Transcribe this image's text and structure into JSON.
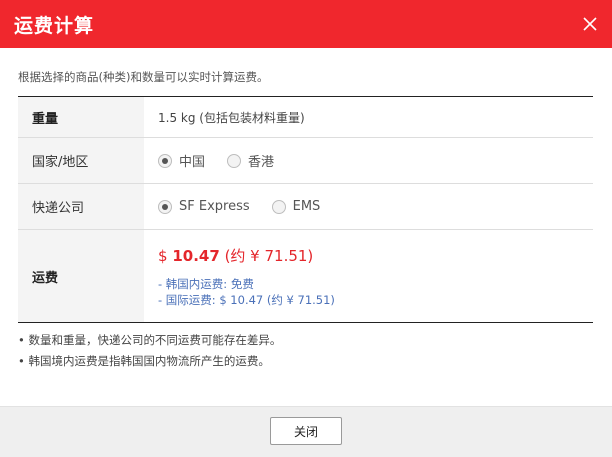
{
  "dialog": {
    "title": "运费计算",
    "description": "根据选择的商品(种类)和数量可以实时计算运费。"
  },
  "table": {
    "weight": {
      "label": "重量",
      "value": "1.5 kg (包括包装材料重量)"
    },
    "country": {
      "label": "国家/地区",
      "options": [
        {
          "label": "中国",
          "selected": true
        },
        {
          "label": "香港",
          "selected": false
        }
      ]
    },
    "courier": {
      "label": "快递公司",
      "options": [
        {
          "label": "SF Express",
          "selected": true
        },
        {
          "label": "EMS",
          "selected": false
        }
      ]
    },
    "fee": {
      "label": "运费",
      "currency": "$",
      "amount": "10.47",
      "approx": "(约 ¥ 71.51)",
      "domestic": "- 韩国内运费: 免费",
      "international": "- 国际运费: $ 10.47 (约 ¥ 71.51)"
    }
  },
  "notes": [
    "• 数量和重量，快递公司的不同运费可能存在差异。",
    "• 韩国境内运费是指韩国国内物流所产生的运费。"
  ],
  "footer": {
    "close_label": "关闭"
  },
  "colors": {
    "header_bg": "#f0272d",
    "fee_red": "#e4262b",
    "link_blue": "#4a70b8"
  },
  "icons": {
    "close": "close-icon"
  }
}
